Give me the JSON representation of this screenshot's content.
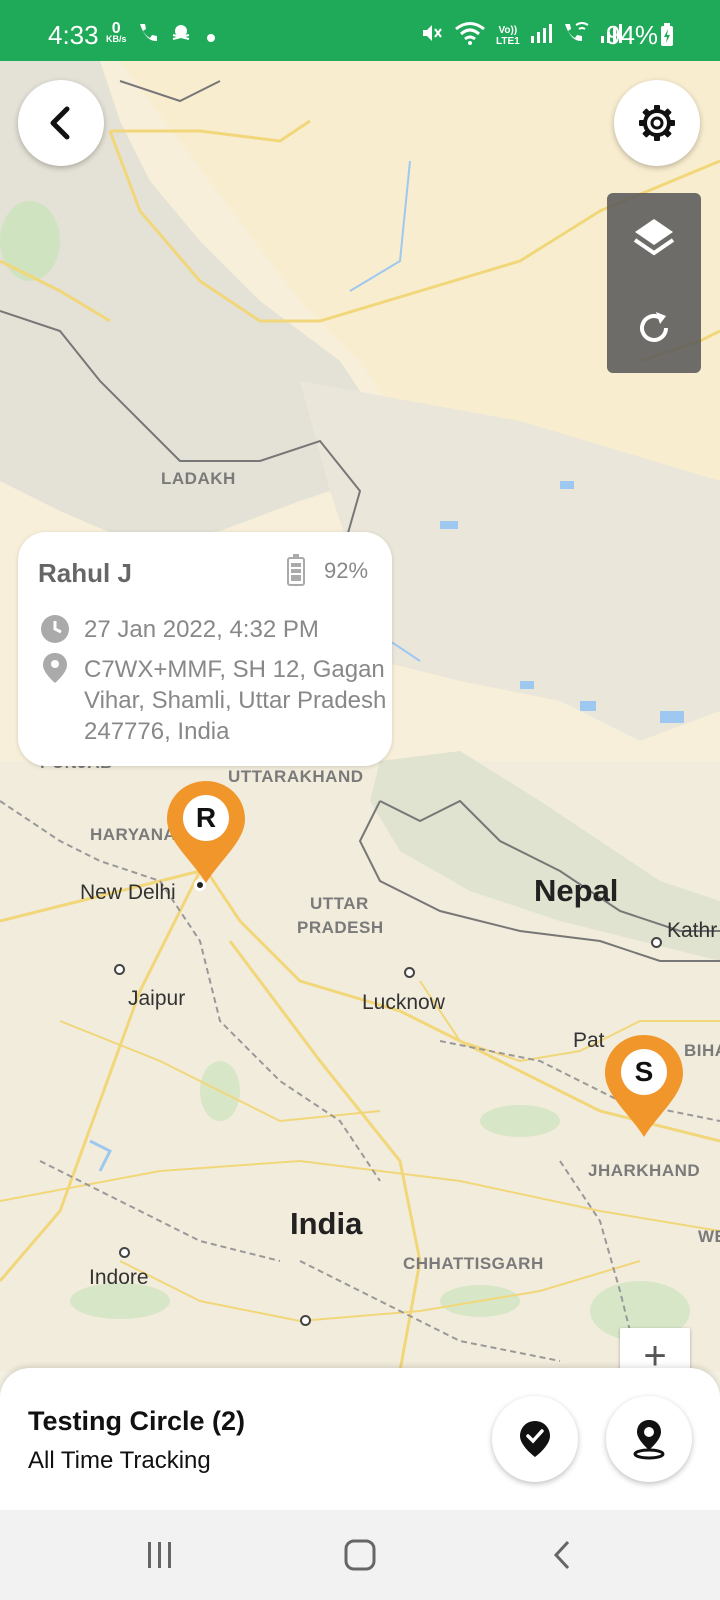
{
  "status_bar": {
    "time": "4:33",
    "speed_value": "0",
    "speed_unit": "KB/s",
    "battery_percent": "94%",
    "icons": [
      "call-icon",
      "pirate-icon",
      "dot-icon",
      "mute-icon",
      "wifi-icon",
      "volte-icon",
      "signal-icon",
      "wifi-call-icon",
      "signal-icon",
      "battery-charging-icon"
    ]
  },
  "map": {
    "regions": [
      "LADAKH",
      "PUNJAB",
      "UTTARAKHAND",
      "HARYANA",
      "UTTAR",
      "PRADESH",
      "JHARKHAND",
      "CHHATTISGARH",
      "BIHA",
      "WE"
    ],
    "cities": [
      "New Delhi",
      "Jaipur",
      "Lucknow",
      "Indore",
      "Kathr",
      "Pat"
    ],
    "countries": [
      "Nepal",
      "India"
    ]
  },
  "top_controls": {
    "back_icon": "chevron-left-icon",
    "settings_icon": "gear-icon",
    "layers_icon": "layers-icon",
    "refresh_icon": "refresh-icon"
  },
  "info_card": {
    "name": "Rahul J",
    "battery": "92%",
    "timestamp": "27 Jan 2022, 4:32 PM",
    "address": "C7WX+MMF, SH 12, Gagan Vihar, Shamli, Uttar Pradesh 247776, India"
  },
  "markers": [
    {
      "letter": "R",
      "color": "#f0962a"
    },
    {
      "letter": "S",
      "color": "#f0962a"
    }
  ],
  "zoom": {
    "plus": "+"
  },
  "bottom_sheet": {
    "circle_name": "Testing Circle (2)",
    "tracking_mode": "All Time Tracking",
    "check_icon": "check-badge-icon",
    "location_icon": "location-pin-icon"
  },
  "colors": {
    "status_bar": "#1faa59",
    "marker": "#f0962a"
  }
}
